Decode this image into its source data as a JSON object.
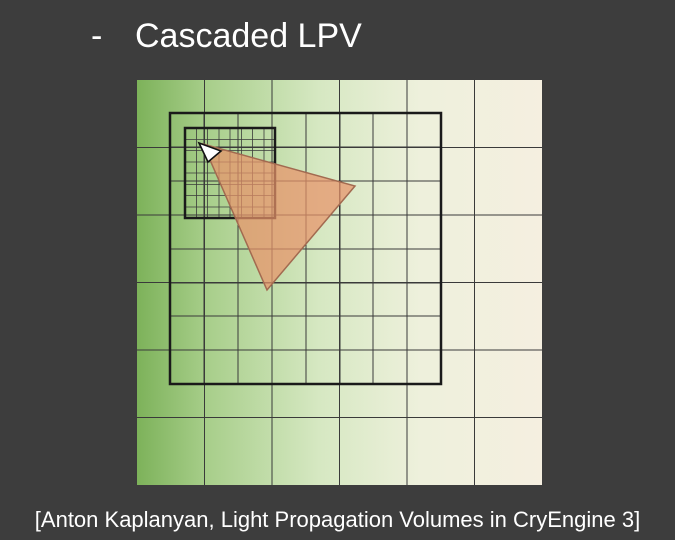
{
  "slide": {
    "bullet": "-",
    "title": "Cascaded LPV",
    "caption": "[Anton Kaplanyan, Light Propagation Volumes in CryEngine 3]"
  },
  "colors": {
    "background": "#3d3d3d",
    "text": "#ffffff",
    "gradient_green": "#8fbc6e",
    "gradient_light": "#e4efd4",
    "gradient_cream": "#f5f0e2",
    "grid_line": "#333333",
    "triangle_fill": "#e8936a",
    "triangle_stroke": "#a26a50"
  },
  "diagram": {
    "outer_grid_cells": 6,
    "middle_grid_cells": 8,
    "inner_grid_cells": 8
  }
}
